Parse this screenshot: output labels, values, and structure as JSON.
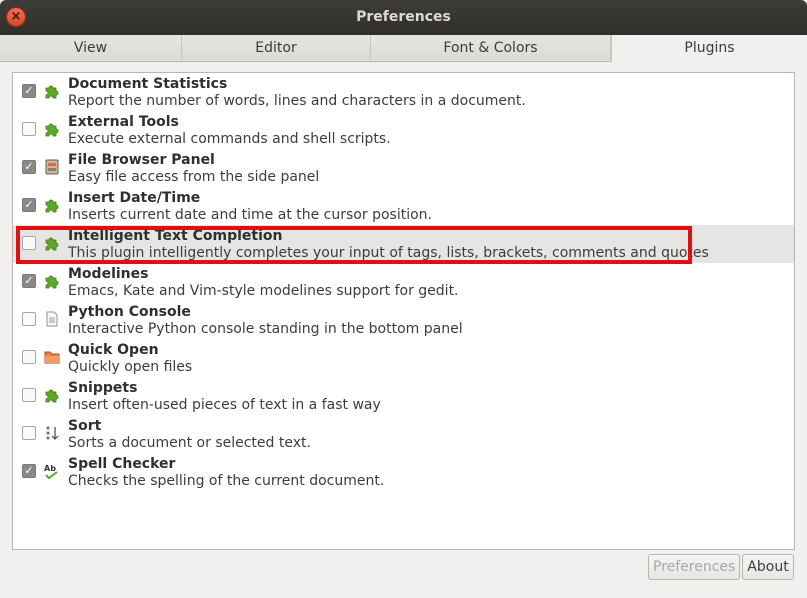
{
  "window": {
    "title": "Preferences",
    "close_icon": "×"
  },
  "tabs": [
    {
      "label": "View"
    },
    {
      "label": "Editor"
    },
    {
      "label": "Font & Colors"
    },
    {
      "label": "Plugins"
    }
  ],
  "plugins": [
    {
      "name": "Document Statistics",
      "description": "Report the number of words, lines and characters in a document.",
      "enabled": true,
      "icon": "puzzle-icon"
    },
    {
      "name": "External Tools",
      "description": "Execute external commands and shell scripts.",
      "enabled": false,
      "icon": "puzzle-icon"
    },
    {
      "name": "File Browser Panel",
      "description": "Easy file access from the side panel",
      "enabled": true,
      "icon": "file-cabinet-icon"
    },
    {
      "name": "Insert Date/Time",
      "description": "Inserts current date and time at the cursor position.",
      "enabled": true,
      "icon": "puzzle-icon"
    },
    {
      "name": "Intelligent Text Completion",
      "description": "This plugin intelligently completes your input of tags, lists, brackets, comments and quotes",
      "enabled": false,
      "icon": "puzzle-icon"
    },
    {
      "name": "Modelines",
      "description": "Emacs, Kate and Vim-style modelines support for gedit.",
      "enabled": true,
      "icon": "puzzle-icon"
    },
    {
      "name": "Python Console",
      "description": "Interactive Python console standing in the bottom panel",
      "enabled": false,
      "icon": "document-icon"
    },
    {
      "name": "Quick Open",
      "description": "Quickly open files",
      "enabled": false,
      "icon": "folder-icon"
    },
    {
      "name": "Snippets",
      "description": "Insert often-used pieces of text in a fast way",
      "enabled": false,
      "icon": "puzzle-icon"
    },
    {
      "name": "Sort",
      "description": "Sorts a document or selected text.",
      "enabled": false,
      "icon": "sort-icon"
    },
    {
      "name": "Spell Checker",
      "description": "Checks the spelling of the current document.",
      "enabled": true,
      "icon": "spellcheck-icon"
    }
  ],
  "buttons": {
    "preferences": "Preferences",
    "about": "About"
  },
  "colors": {
    "highlight": "#e10f10",
    "puzzle": "#5ea82a"
  }
}
